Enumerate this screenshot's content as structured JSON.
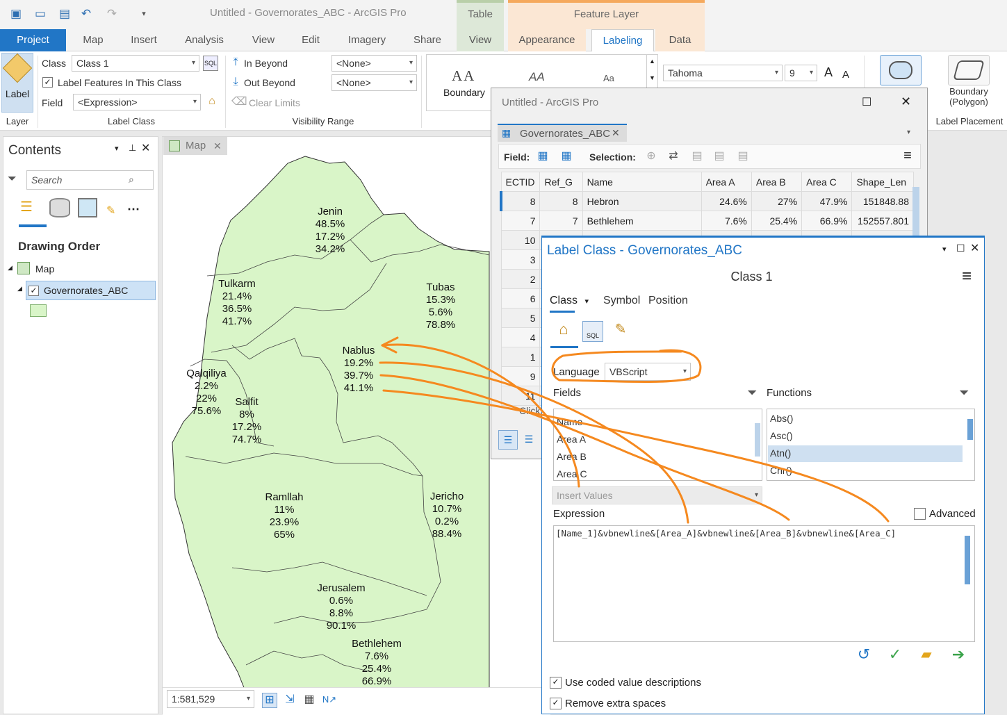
{
  "window_title": "Untitled - Governorates_ABC - ArcGIS Pro",
  "context_tabs": {
    "table": "Table",
    "feature_layer": "Feature Layer"
  },
  "tabs": [
    "Project",
    "Map",
    "Insert",
    "Analysis",
    "View",
    "Edit",
    "Imagery",
    "Share",
    "View",
    "Appearance",
    "Labeling",
    "Data"
  ],
  "ribbon": {
    "label_button": "Label",
    "class_label": "Class",
    "class_value": "Class 1",
    "label_features_checkbox": "Label Features In This Class",
    "field_label": "Field",
    "field_value": "<Expression>",
    "in_beyond": "In Beyond",
    "out_beyond": "Out Beyond",
    "clear_limits": "Clear Limits",
    "in_beyond_value": "<None>",
    "out_beyond_value": "<None>",
    "style_boundary": "Boundary",
    "font_name": "Tahoma",
    "font_size": "9",
    "boundary_polygon": "Boundary\n(Polygon)",
    "group_layer": "Layer",
    "group_label_class": "Label Class",
    "group_visibility": "Visibility Range",
    "group_label_placement": "Label Placement"
  },
  "contents": {
    "title": "Contents",
    "search_placeholder": "Search",
    "drawing_order": "Drawing Order",
    "map_item": "Map",
    "layer_item": "Governorates_ABC"
  },
  "map_tab": "Map",
  "map_labels": [
    {
      "name": "Jenin",
      "a": "48.5%",
      "b": "17.2%",
      "c": "34.2%"
    },
    {
      "name": "Tulkarm",
      "a": "21.4%",
      "b": "36.5%",
      "c": "41.7%"
    },
    {
      "name": "Tubas",
      "a": "15.3%",
      "b": "5.6%",
      "c": "78.8%"
    },
    {
      "name": "Nablus",
      "a": "19.2%",
      "b": "39.7%",
      "c": "41.1%"
    },
    {
      "name": "Qalqiliya",
      "a": "2.2%",
      "b": "22%",
      "c": "75.6%"
    },
    {
      "name": "Salfit",
      "a": "8%",
      "b": "17.2%",
      "c": "74.7%"
    },
    {
      "name": "Ramllah",
      "a": "11%",
      "b": "23.9%",
      "c": "65%"
    },
    {
      "name": "Jericho",
      "a": "10.7%",
      "b": "0.2%",
      "c": "88.4%"
    },
    {
      "name": "Jerusalem",
      "a": "0.6%",
      "b": "8.8%",
      "c": "90.1%"
    },
    {
      "name": "Bethlehem",
      "a": "7.6%",
      "b": "25.4%",
      "c": "66.9%"
    }
  ],
  "scale": "1:581,529",
  "table_window": {
    "title": "Untitled - ArcGIS Pro",
    "tab": "Governorates_ABC",
    "field_label": "Field:",
    "selection_label": "Selection:",
    "columns": [
      "ECTID",
      "Ref_G",
      "Name",
      "Area A",
      "Area B",
      "Area C",
      "Shape_Len"
    ],
    "rows": [
      [
        "8",
        "8",
        "Hebron",
        "24.6%",
        "27%",
        "47.9%",
        "151848.88"
      ],
      [
        "7",
        "7",
        "Bethlehem",
        "7.6%",
        "25.4%",
        "66.9%",
        "152557.801"
      ],
      [
        "10",
        "",
        "",
        "",
        "",
        "",
        ""
      ],
      [
        "3",
        "",
        "",
        "",
        "",
        "",
        ""
      ],
      [
        "2",
        "",
        "",
        "",
        "",
        "",
        ""
      ],
      [
        "6",
        "",
        "",
        "",
        "",
        "",
        ""
      ],
      [
        "5",
        "",
        "",
        "",
        "",
        "",
        ""
      ],
      [
        "4",
        "",
        "",
        "",
        "",
        "",
        ""
      ],
      [
        "1",
        "",
        "",
        "",
        "",
        "",
        ""
      ],
      [
        "9",
        "",
        "",
        "",
        "",
        "",
        ""
      ],
      [
        "11",
        "",
        "",
        "",
        "",
        "",
        ""
      ]
    ],
    "click_text": "Click"
  },
  "label_class": {
    "title": "Label Class - Governorates_ABC",
    "class_name": "Class 1",
    "subtabs": [
      "Class",
      "Symbol",
      "Position"
    ],
    "language_label": "Language",
    "language_value": "VBScript",
    "fields_label": "Fields",
    "functions_label": "Functions",
    "fields": [
      "Name",
      "Area A",
      "Area B",
      "Area C"
    ],
    "functions": [
      "Abs()",
      "Asc()",
      "Atn()",
      "Chr()"
    ],
    "insert_values": "Insert Values",
    "expression_label": "Expression",
    "advanced_label": "Advanced",
    "expression": "[Name_1]&vbnewline&[Area_A]&vbnewline&[Area_B]&vbnewline&[Area_C]",
    "use_coded": "Use coded value descriptions",
    "remove_spaces": "Remove extra spaces"
  },
  "colors": {
    "accent": "#2176c6",
    "map_fill": "#d9f5c8",
    "annotation": "#f5891f"
  }
}
